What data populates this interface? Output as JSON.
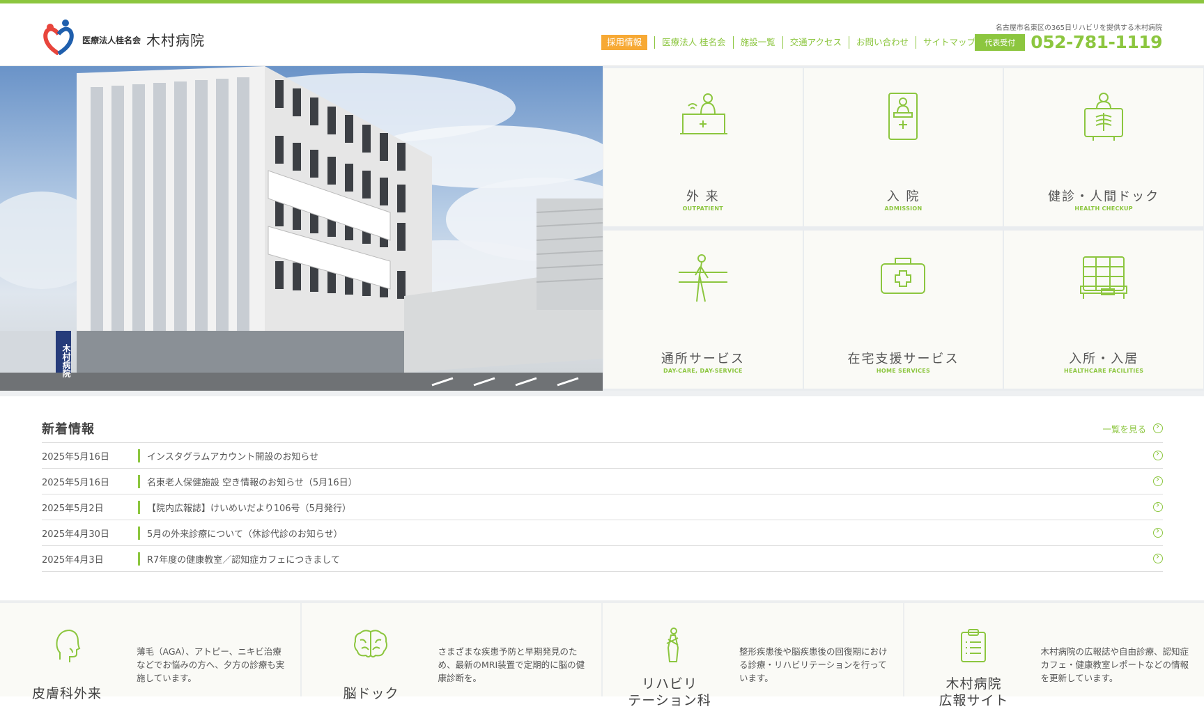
{
  "header": {
    "corp": "医療法人桂名会",
    "name": "木村病院",
    "tagline": "名古屋市名東区の365日リハビリを提供する木村病院",
    "phone_badge": "代表受付",
    "phone": "052-781-1119",
    "nav": [
      "採用情報",
      "医療法人 桂名会",
      "施設一覧",
      "交通アクセス",
      "お問い合わせ",
      "サイトマップ"
    ]
  },
  "hero": {
    "sign": "木村病院"
  },
  "services": [
    {
      "jp": "外 来",
      "en": "OUTPATIENT",
      "icon": "reception-desk-icon"
    },
    {
      "jp": "入 院",
      "en": "ADMISSION",
      "icon": "patient-tag-icon"
    },
    {
      "jp": "健診・人間ドック",
      "en": "HEALTH CHECKUP",
      "icon": "xray-person-icon"
    },
    {
      "jp": "通所サービス",
      "en": "DAY-CARE, DAY-SERVICE",
      "icon": "walking-bars-icon"
    },
    {
      "jp": "在宅支援サービス",
      "en": "HOME SERVICES",
      "icon": "medical-bag-icon"
    },
    {
      "jp": "入所・入居",
      "en": "HEALTHCARE FACILITIES",
      "icon": "facility-icon"
    }
  ],
  "news": {
    "title": "新着情報",
    "more": "一覧を見る",
    "items": [
      {
        "date": "2025年5月16日",
        "text": "インスタグラムアカウント開設のお知らせ"
      },
      {
        "date": "2025年5月16日",
        "text": "名東老人保健施設 空き情報のお知らせ（5月16日）"
      },
      {
        "date": "2025年5月2日",
        "text": "【院内広報誌】けいめいだより106号（5月発行）"
      },
      {
        "date": "2025年4月30日",
        "text": "5月の外来診療について（休診代診のお知らせ）"
      },
      {
        "date": "2025年4月3日",
        "text": "R7年度の健康教室／認知症カフェにつきまして"
      }
    ]
  },
  "cards": [
    {
      "name": "皮膚科外来",
      "desc": "薄毛（AGA）、アトピー、ニキビ治療などでお悩みの方へ、夕方の診療も実施しています。"
    },
    {
      "name": "脳ドック",
      "desc": "さまざまな疾患予防と早期発見のため、最新のMRI装置で定期的に脳の健康診断を。"
    },
    {
      "name": "リハビリ\nテーション科",
      "desc": "整形疾患後や脳疾患後の回復期における診療・リハビリテーションを行っています。"
    },
    {
      "name": "木村病院\n広報サイト",
      "desc": "木村病院の広報誌や自由診療、認知症カフェ・健康教室レポートなどの情報を更新しています。"
    }
  ],
  "colors": {
    "accent": "#8cc63f",
    "recruit": "#f7a934"
  }
}
